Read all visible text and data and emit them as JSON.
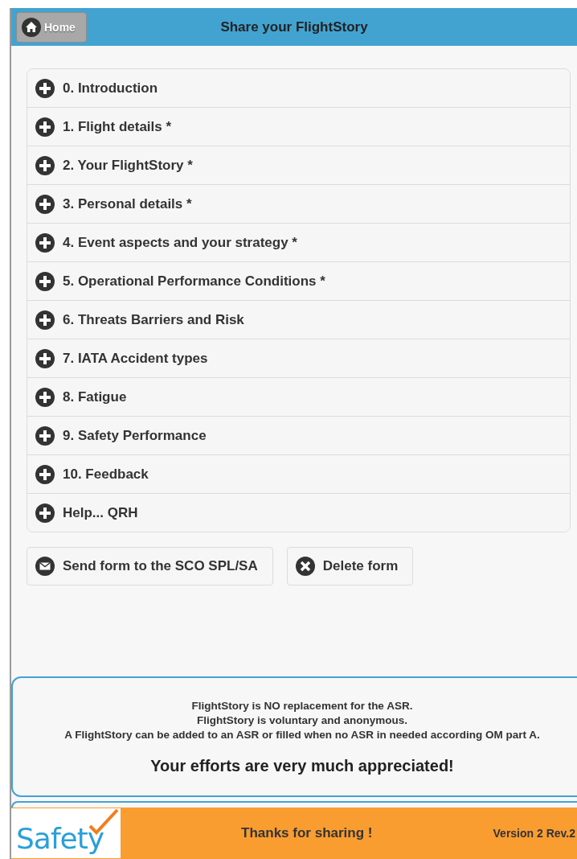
{
  "header": {
    "home_button": "Home",
    "title": "Share your FlightStory"
  },
  "sections": [
    {
      "label": "0. Introduction",
      "expanded": false
    },
    {
      "label": "1. Flight details *",
      "expanded": false
    },
    {
      "label": "2. Your FlightStory *",
      "expanded": false
    },
    {
      "label": "3. Personal details *",
      "expanded": false
    },
    {
      "label": "4. Event aspects and your strategy *",
      "expanded": false
    },
    {
      "label": "5. Operational Performance Conditions *",
      "expanded": false
    },
    {
      "label": "6. Threats Barriers and Risk",
      "expanded": false
    },
    {
      "label": "7. IATA Accident types",
      "expanded": false
    },
    {
      "label": "8. Fatigue",
      "expanded": false
    },
    {
      "label": "9. Safety Performance",
      "expanded": false
    },
    {
      "label": "10. Feedback",
      "expanded": false
    },
    {
      "label": "Help... QRH",
      "expanded": false
    }
  ],
  "actions": [
    {
      "label": "Send form to the SCO SPL/SA",
      "kind": "send"
    },
    {
      "label": "Delete form",
      "kind": "delete"
    }
  ],
  "notice": {
    "lines": [
      "FlightStory is NO replacement for the ASR.",
      "FlightStory is voluntary and anonymous.",
      "A FlightStory can be added to an ASR or filled when no ASR in needed according OM part A."
    ],
    "closing": "Your efforts are very much appreciated!"
  },
  "footer": {
    "logo": "Safety",
    "message": "Thanks for sharing !",
    "version": "Version 2 Rev.2"
  }
}
